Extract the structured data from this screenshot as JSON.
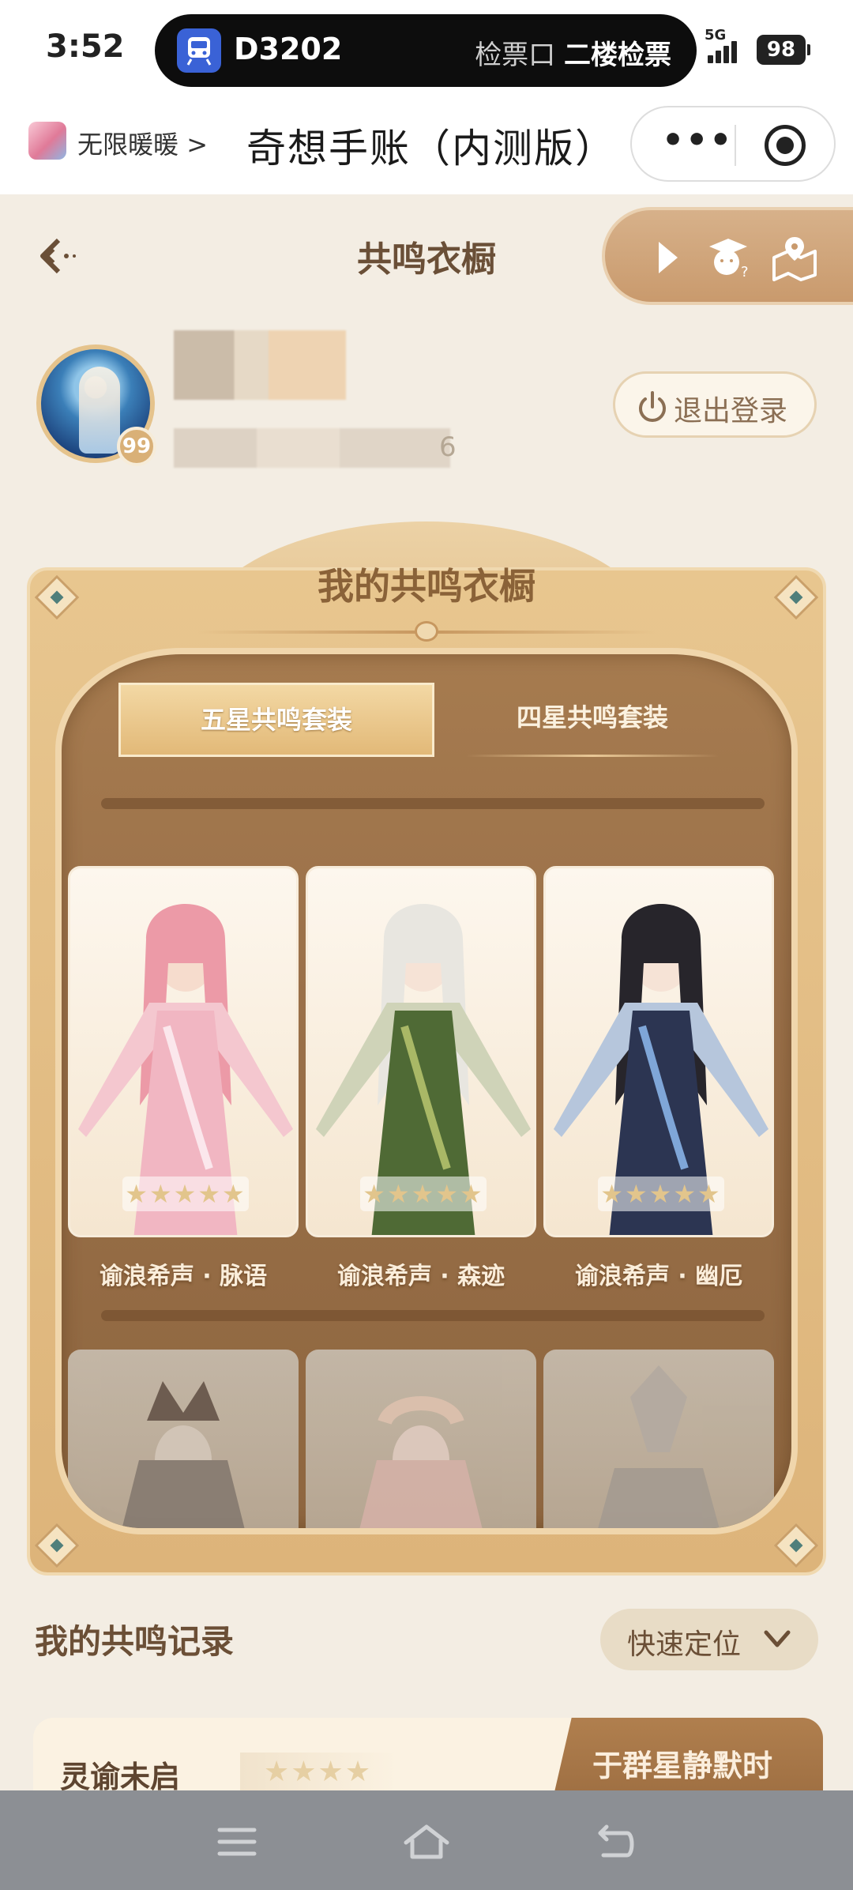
{
  "status_bar": {
    "time": "3:52",
    "train_number": "D3202",
    "ticket_gate_label": "检票口",
    "ticket_gate_value": "二楼检票",
    "network": "5G",
    "battery": "98"
  },
  "mini_program": {
    "app_name": "无限暖暖",
    "chevron": ">",
    "title": "奇想手账（内测版）",
    "more_icon": "more-dots-icon",
    "close_icon": "target-icon"
  },
  "page": {
    "title": "共鸣衣橱",
    "back_icon": "back-arrow-icon",
    "toolbar_icons": [
      "play-icon",
      "mascot-icon",
      "map-icon"
    ]
  },
  "profile": {
    "level": "99",
    "uid_tail": "6",
    "logout_label": "退出登录"
  },
  "wardrobe": {
    "title": "我的共鸣衣橱",
    "tabs": [
      {
        "label": "五星共鸣套装",
        "active": true
      },
      {
        "label": "四星共鸣套装",
        "active": false
      }
    ],
    "row1": [
      {
        "name": "谕浪希声 · 脉语",
        "stars": "★★★★★",
        "tone": "pink"
      },
      {
        "name": "谕浪希声 · 森迹",
        "stars": "★★★★★",
        "tone": "green"
      },
      {
        "name": "谕浪希声 · 幽厄",
        "stars": "★★★★★",
        "tone": "blue"
      }
    ]
  },
  "records": {
    "title": "我的共鸣记录",
    "locate_label": "快速定位",
    "first": {
      "name": "灵谕未启",
      "stars": "★★★★",
      "tag": "于群星静默时"
    }
  },
  "colors": {
    "accent": "#d9b077",
    "panel": "#e4c390",
    "wood": "#9a7049"
  }
}
